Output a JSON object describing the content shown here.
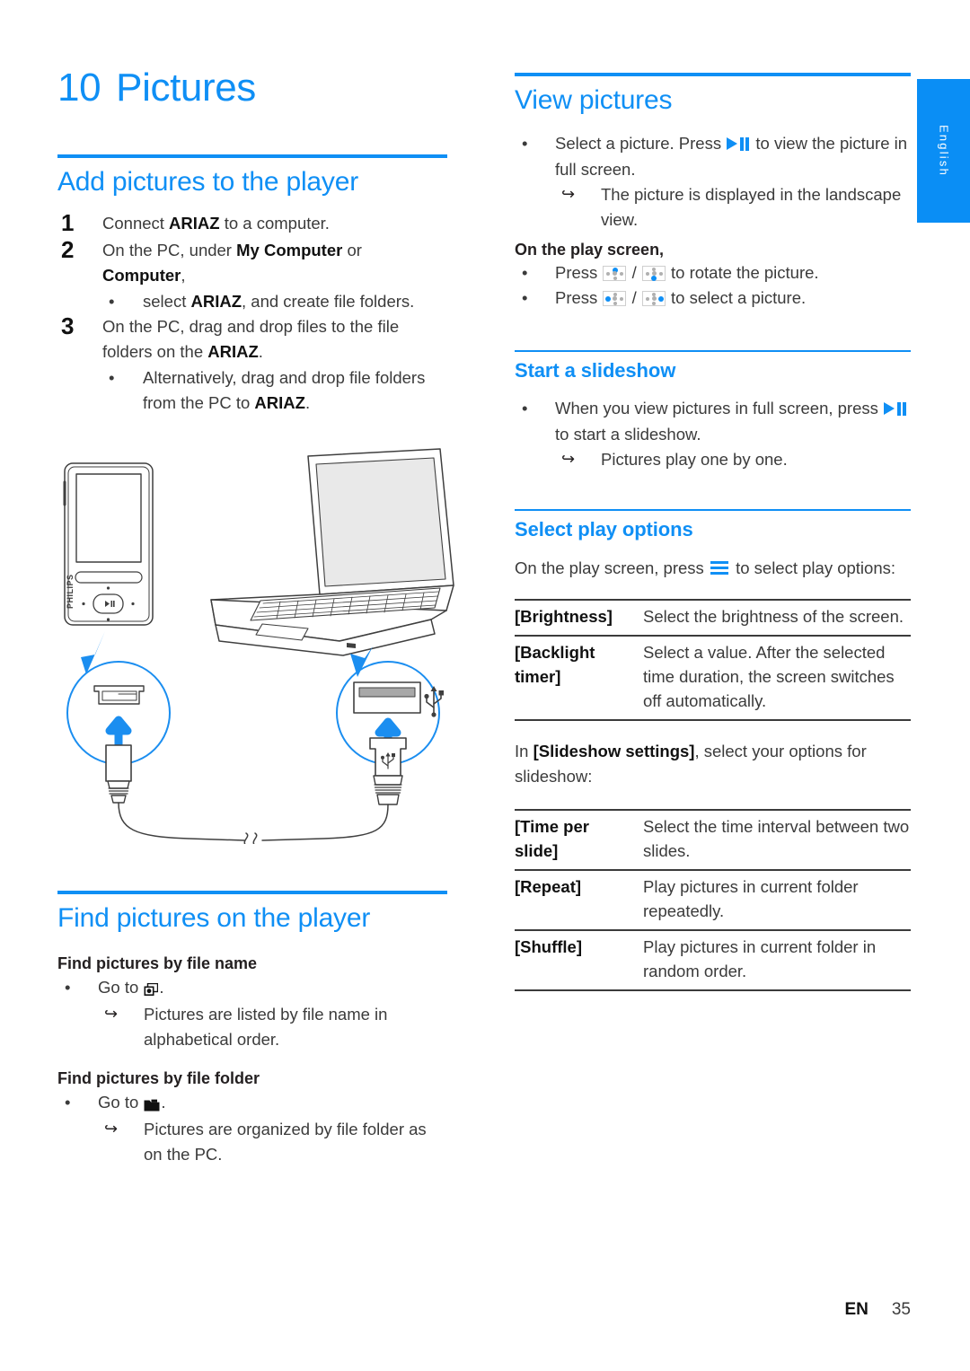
{
  "page": {
    "chapter_number": "10",
    "chapter_title": "Pictures",
    "language_tab": "English",
    "footer_code": "EN",
    "footer_page": "35",
    "accent_color": "#0f8ff5",
    "text_color": "#3b3b3b"
  },
  "left": {
    "section1": {
      "heading": "Add pictures to the player",
      "steps": [
        {
          "n": "1",
          "html": "Connect <b>ARIAZ</b> to a computer."
        },
        {
          "n": "2",
          "html": "On the PC, under <b>My Computer</b> or <b>Computer</b>,"
        },
        {
          "n": "3",
          "html": "On the PC, drag and drop files to the file folders on the <b>ARIAZ</b>."
        }
      ],
      "bullet_after_step2": "select <b>ARIAZ</b>, and create file folders.",
      "bullet_after_step3": "Alternatively, drag and drop file folders from the PC to <b>ARIAZ</b>."
    },
    "illustration": {
      "name": "usb-connection-diagram",
      "device_brand": "PHILIPS",
      "callout_left": "mini-usb-port",
      "callout_right": "usb-port",
      "usb_symbol": "usb-icon"
    },
    "section2": {
      "heading": "Find pictures on the player",
      "groups": [
        {
          "title": "Find pictures by file name",
          "bullet_prefix": "Go to ",
          "bullet_icon": "picture-library-icon",
          "bullet_suffix": ".",
          "result": "Pictures are listed by file name in alphabetical order."
        },
        {
          "title": "Find pictures by file folder",
          "bullet_prefix": "Go to ",
          "bullet_icon": "folder-icon",
          "bullet_suffix": ".",
          "result": "Pictures are organized by file folder as on the PC."
        }
      ]
    }
  },
  "right": {
    "section1": {
      "heading": "View pictures",
      "bullet_1_a": "Select a picture. Press ",
      "bullet_1_icon": "play-pause-icon",
      "bullet_1_b": " to view the picture in full screen.",
      "bullet_1_result": "The picture is displayed in the landscape view.",
      "play_screen_label": "On the play screen,",
      "rotate_a": "Press ",
      "rotate_icon_1": "nav-up-icon",
      "rotate_sep": " / ",
      "rotate_icon_2": "nav-down-icon",
      "rotate_b": " to rotate the picture.",
      "select_a": "Press ",
      "select_icon_1": "nav-left-icon",
      "select_sep": " / ",
      "select_icon_2": "nav-right-icon",
      "select_b": " to select a picture."
    },
    "section2": {
      "heading": "Start a slideshow",
      "bullet_a": "When you view pictures in full screen, press ",
      "bullet_icon": "play-pause-icon",
      "bullet_b": " to start a slideshow.",
      "result": "Pictures play one by one."
    },
    "section3": {
      "heading": "Select play options",
      "intro_a": "On the play screen, press ",
      "intro_icon": "menu-icon",
      "intro_b": " to select play options:",
      "table1": [
        {
          "key": "[Brightness]",
          "desc": "Select the brightness of the screen."
        },
        {
          "key": "[Backlight timer]",
          "desc": "Select a value. After the selected time duration, the screen switches off automatically."
        }
      ],
      "slideshow_intro_a": "In ",
      "slideshow_intro_bold": "[Slideshow settings]",
      "slideshow_intro_b": ", select your options for slideshow:",
      "table2": [
        {
          "key": "[Time per slide]",
          "desc": "Select the time interval between two slides."
        },
        {
          "key": "[Repeat]",
          "desc": "Play pictures in current folder repeatedly."
        },
        {
          "key": "[Shuffle]",
          "desc": "Play pictures in current folder in random order."
        }
      ]
    }
  }
}
